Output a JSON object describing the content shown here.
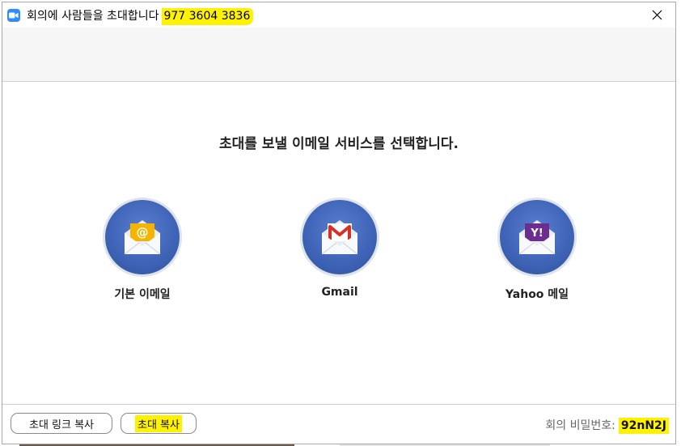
{
  "window": {
    "title": "회의에 사람들을 초대합니다",
    "meeting_id": "977 3604 3836"
  },
  "main": {
    "heading": "초대를 보낼 이메일 서비스를 선택합니다.",
    "services": [
      {
        "label": "기본 이메일",
        "icon": "default-mail-icon",
        "color": "#f5b400"
      },
      {
        "label": "Gmail",
        "icon": "gmail-icon",
        "color": "#d93025"
      },
      {
        "label": "Yahoo 메일",
        "icon": "yahoo-mail-icon",
        "color": "#6b2d8f"
      }
    ]
  },
  "footer": {
    "copy_link_label": "초대 링크 복사",
    "copy_invite_label": "초대 복사",
    "password_label": "회의 비밀번호:",
    "password_value": "92nN2J"
  },
  "colors": {
    "highlight": "#fff200",
    "accent": "#2d8cff",
    "circle": "#4065b8"
  }
}
